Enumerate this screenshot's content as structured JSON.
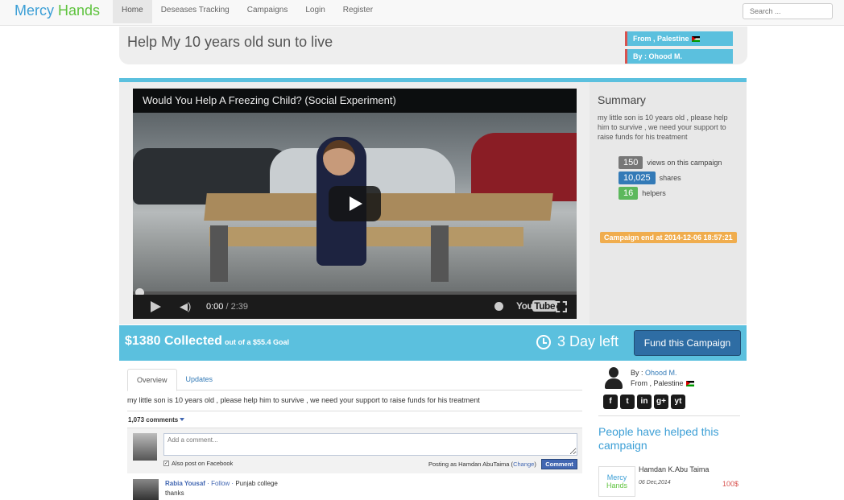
{
  "navbar": {
    "brand_part1": "Mercy",
    "brand_part2": "Hands",
    "items": [
      "Home",
      "Deseases Tracking",
      "Campaigns",
      "Login",
      "Register"
    ],
    "search_placeholder": "Search ..."
  },
  "campaign": {
    "title": "Help My 10 years old sun to live",
    "from": "From , Palestine",
    "by": "By : Ohood M."
  },
  "video": {
    "title": "Would You Help A Freezing Child? (Social Experiment)",
    "current_time": "0:00",
    "duration": "/ 2:39",
    "youtube_label": "You",
    "youtube_label2": "Tube"
  },
  "summary": {
    "heading": "Summary",
    "text": "my little son is 10 years old , please help him to survive , we need your support to raise funds for his treatment",
    "views": "150",
    "views_label": "views on this campaign",
    "shares": "10,025",
    "shares_label": "shares",
    "helpers": "16",
    "helpers_label": "helpers",
    "end_label": "Campaign end at 2014-12-06 18:57:21"
  },
  "funding": {
    "collected": "$1380 Collected",
    "goal": "out of a $55.4 Goal",
    "days_left": "3 Day left",
    "fund_button": "Fund this Campaign"
  },
  "tabs": {
    "overview": "Overview",
    "updates": "Updates"
  },
  "overview_text": "my little son is 10 years old , please help him to survive , we need your support to raise funds for his treatment",
  "comments": {
    "count": "1,073 comments",
    "placeholder": "Add a comment...",
    "also_post": "Also post on Facebook",
    "posting_as": "Posting as Hamdan AbuTaima (",
    "change": "Change",
    "posting_close": ")",
    "button": "Comment",
    "first": {
      "name": "Rabia Yousaf",
      "follow": "· Follow ·",
      "school": "Punjab college",
      "text": "thanks"
    }
  },
  "owner": {
    "by_prefix": "By : ",
    "name": "Ohood M.",
    "from": "From , Palestine",
    "socials": [
      "f",
      "t",
      "in",
      "g+",
      "yt"
    ]
  },
  "helped": {
    "title": "People have helped this campaign",
    "helper_logo1": "Mercy",
    "helper_logo2": "Hands",
    "helper_name": "Hamdan K.Abu Taima",
    "helper_date": "06 Dec,2014",
    "helper_amount": "100$"
  },
  "colors": {
    "accent": "#5bc0de",
    "brand_blue": "#3c9fd6",
    "brand_green": "#5fc33f",
    "button": "#2e6da4",
    "warning": "#f0ad4e"
  }
}
